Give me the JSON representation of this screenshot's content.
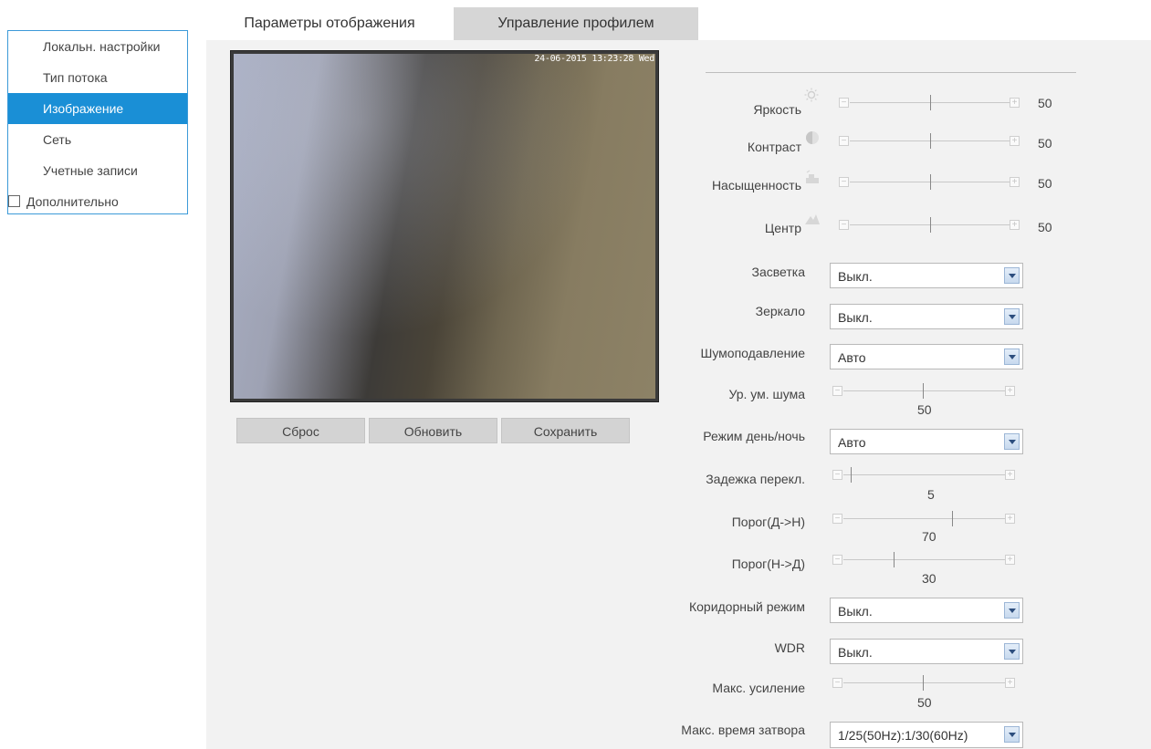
{
  "sidebar": {
    "items": [
      {
        "label": "Локальн. настройки"
      },
      {
        "label": "Тип потока"
      },
      {
        "label": "Изображение"
      },
      {
        "label": "Сеть"
      },
      {
        "label": "Учетные записи"
      },
      {
        "label": "Дополнительно"
      }
    ],
    "active_item": "Изображение"
  },
  "tabs": [
    {
      "label": "Параметры отображения",
      "active": true
    },
    {
      "label": "Управление профилем",
      "active": false
    }
  ],
  "preview": {
    "timestamp": "24-06-2015 13:23:28 Wed"
  },
  "buttons": {
    "reset": "Сброс",
    "refresh": "Обновить",
    "save": "Сохранить"
  },
  "image_sliders": [
    {
      "label": "Яркость",
      "icon": "sun-icon",
      "value": "50"
    },
    {
      "label": "Контраст",
      "icon": "contrast-icon",
      "value": "50"
    },
    {
      "label": "Насыщенность",
      "icon": "saturation-icon",
      "value": "50"
    },
    {
      "label": "Центр",
      "icon": "sharpness-icon",
      "value": "50"
    }
  ],
  "settings": {
    "backlight": {
      "label": "Засветка",
      "value": "Выкл."
    },
    "mirror": {
      "label": "Зеркало",
      "value": "Выкл."
    },
    "noise_reduction": {
      "label": "Шумоподавление",
      "value": "Авто"
    },
    "noise_level": {
      "label": "Ур. ум. шума",
      "value": "50"
    },
    "day_night": {
      "label": "Режим день/ночь",
      "value": "Авто"
    },
    "switch_delay": {
      "label": "Задежка перекл.",
      "value": "5"
    },
    "threshold_dn": {
      "label": "Порог(Д->Н)",
      "value": "70"
    },
    "threshold_nd": {
      "label": "Порог(Н->Д)",
      "value": "30"
    },
    "corridor": {
      "label": "Коридорный режим",
      "value": "Выкл."
    },
    "wdr": {
      "label": "WDR",
      "value": "Выкл."
    },
    "max_gain": {
      "label": "Макс. усиление",
      "value": "50"
    },
    "max_shutter": {
      "label": "Макс. время затвора",
      "value": "1/25(50Hz):1/30(60Hz)"
    }
  },
  "colors": {
    "accent": "#1a8fd6",
    "panel_bg": "#f2f2f2",
    "inactive_tab": "#d6d6d6"
  }
}
